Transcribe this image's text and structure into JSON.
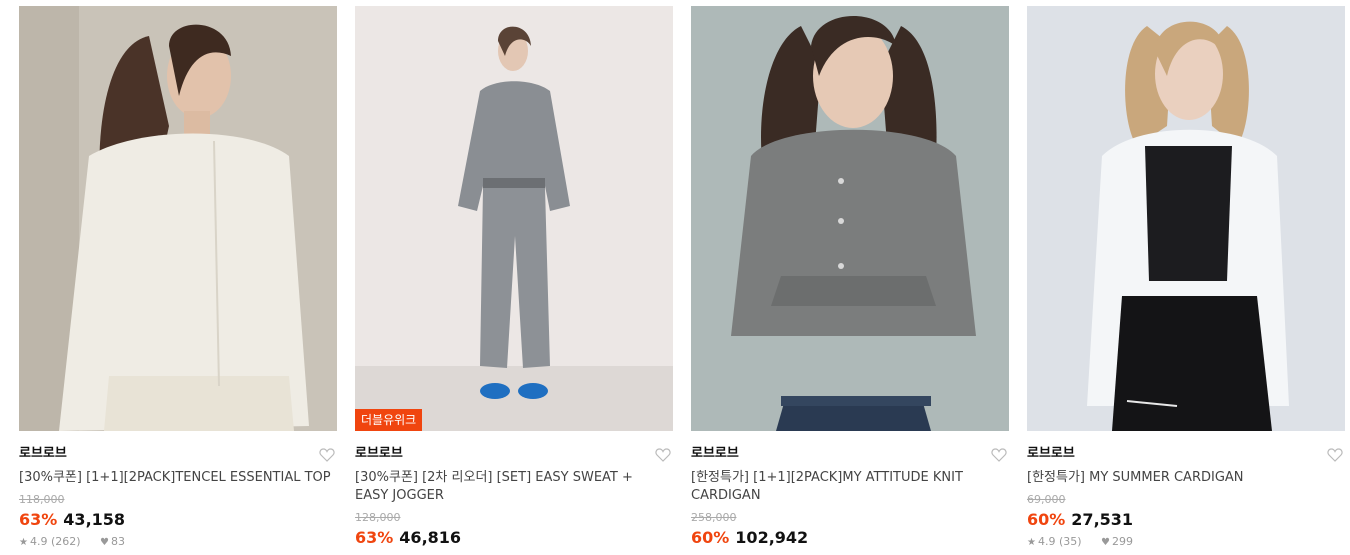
{
  "products": [
    {
      "brand": "로브로브",
      "title": "[30%쿠폰] [1+1][2PACK]TENCEL ESSENTIAL TOP",
      "original_price": "118,000",
      "discount": "63%",
      "price": "43,158",
      "rating": "4.9 (262)",
      "likes": "83",
      "badge": "",
      "image": "woman in cream sheer long-sleeve top"
    },
    {
      "brand": "로브로브",
      "title": "[30%쿠폰] [2차 리오더] [SET] EASY SWEAT + EASY JOGGER",
      "original_price": "128,000",
      "discount": "63%",
      "price": "46,816",
      "rating": "",
      "likes": "",
      "badge": "더블유위크",
      "image": "woman in grey knit sweat set with blue sneakers"
    },
    {
      "brand": "로브로브",
      "title": "[한정특가] [1+1][2PACK]MY ATTITUDE KNIT CARDIGAN",
      "original_price": "258,000",
      "discount": "60%",
      "price": "102,942",
      "rating": "",
      "likes": "",
      "badge": "",
      "image": "woman in grey knit cardigan and jeans"
    },
    {
      "brand": "로브로브",
      "title": "[한정특가] MY SUMMER CARDIGAN",
      "original_price": "69,000",
      "discount": "60%",
      "price": "27,531",
      "rating": "4.9 (35)",
      "likes": "299",
      "badge": "",
      "image": "woman in white cardigan over black top"
    }
  ],
  "icons": {
    "wishlist": "heart-outline-icon",
    "rating": "star-icon",
    "likes": "heart-filled-icon"
  },
  "colors": {
    "accent": "#f0450f",
    "strike": "#aaaaaa"
  }
}
